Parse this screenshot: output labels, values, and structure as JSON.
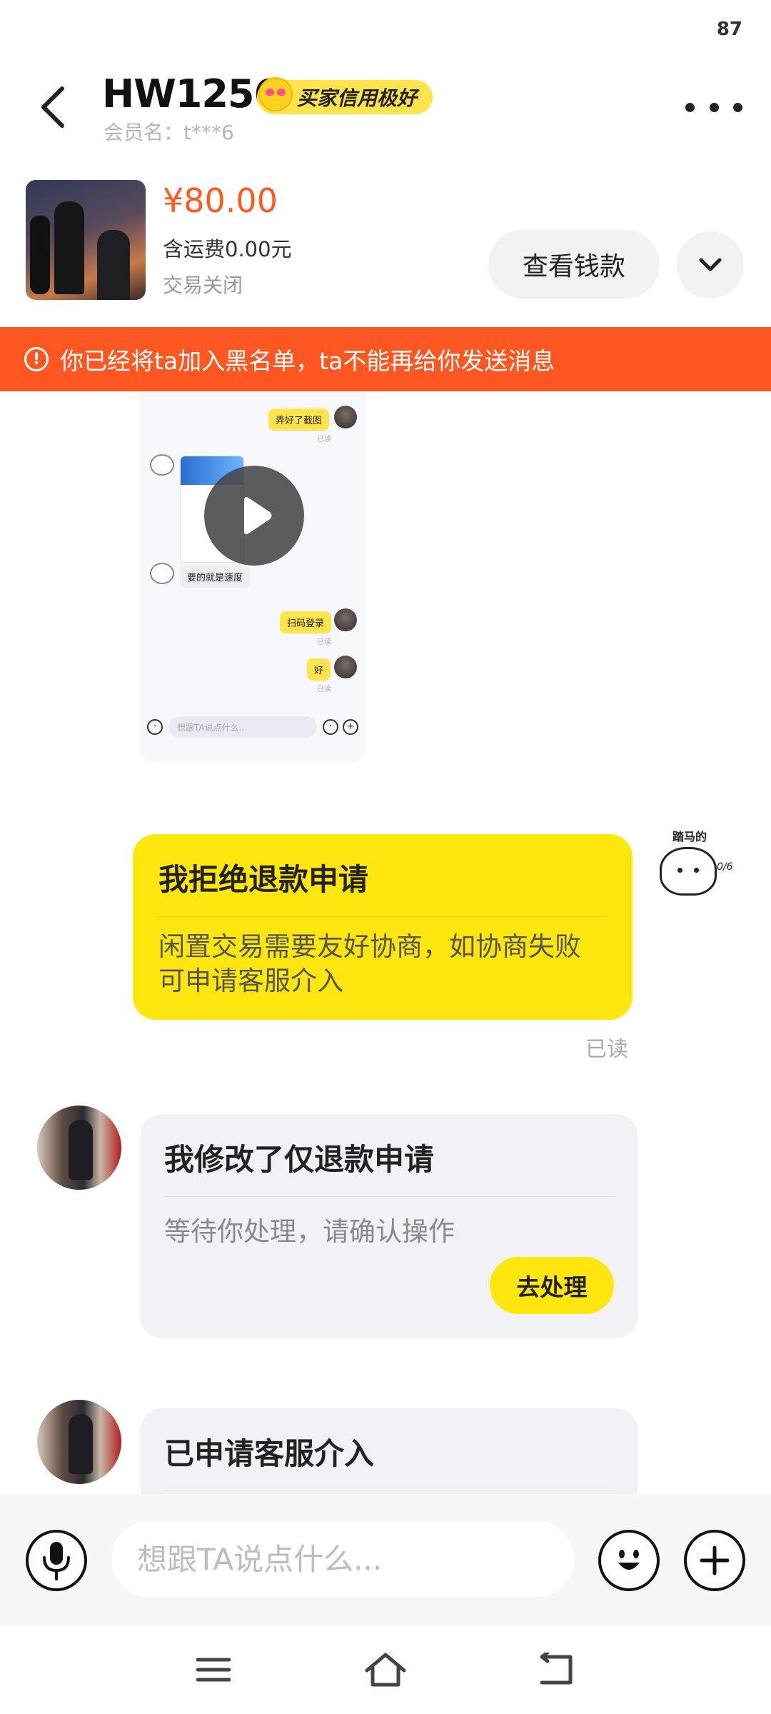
{
  "status_bar": {
    "battery": "87"
  },
  "header": {
    "title": "HW1256",
    "credit_badge": "买家信用极好",
    "member_name": "会员名：t***6"
  },
  "product": {
    "price": "¥80.00",
    "shipping": "含运费0.00元",
    "status": "交易关闭",
    "view_payment": "查看钱款"
  },
  "banner": {
    "text": "你已经将ta加入黑名单，ta不能再给你发送消息"
  },
  "video_preview": {
    "msg1": "弄好了截图",
    "msg2": "要的就是速度",
    "msg3": "扫码登录",
    "msg4": "好",
    "read": "已读",
    "input_placeholder": "想跟TA说点什么..."
  },
  "messages": [
    {
      "title": "我拒绝退款申请",
      "desc": "闲置交易需要友好协商，如协商失败可申请客服介入",
      "read": "已读",
      "sticker_caption": "踏马的",
      "sticker_tag": "0/6"
    },
    {
      "title": "我修改了仅退款申请",
      "desc": "等待你处理，请确认操作",
      "button": "去处理"
    },
    {
      "title": "已申请客服介入"
    }
  ],
  "input": {
    "placeholder": "想跟TA说点什么..."
  },
  "colors": {
    "brand_yellow": "#ffe60f",
    "price_orange": "#ff5a1f",
    "banner_orange": "#ff5722"
  }
}
